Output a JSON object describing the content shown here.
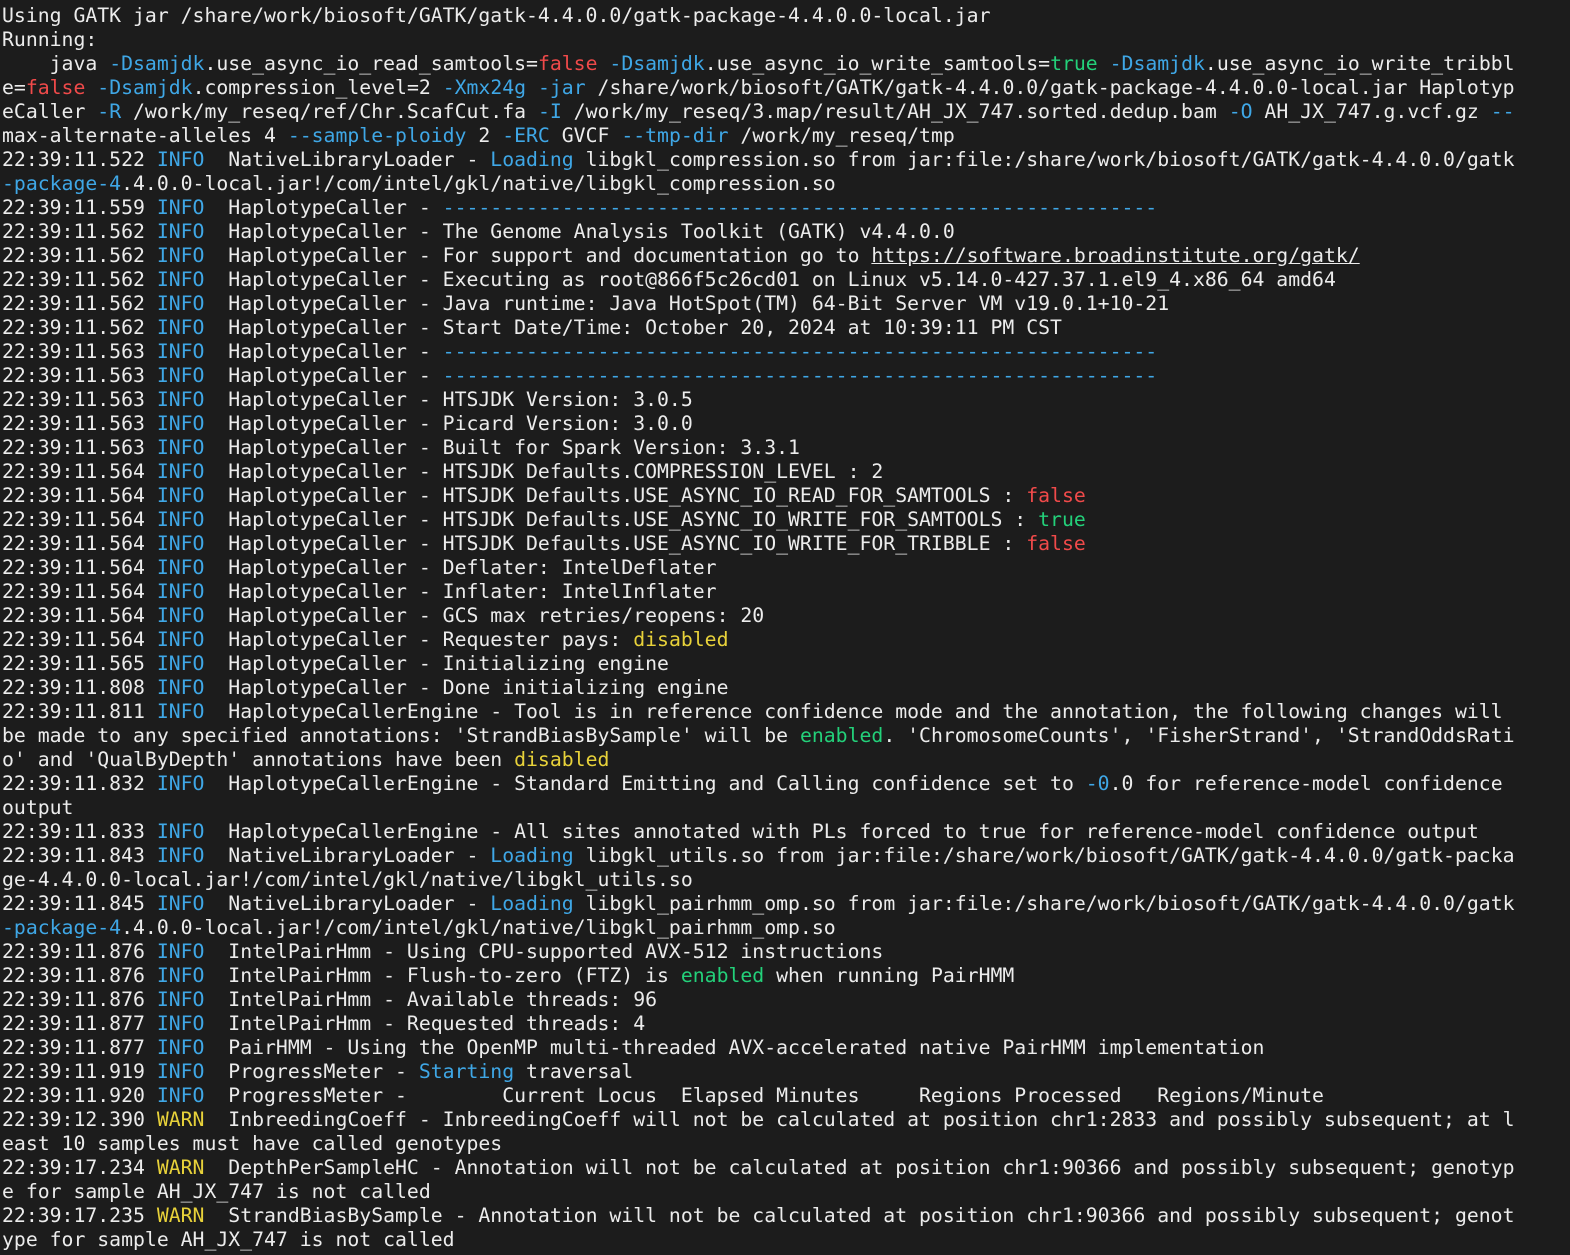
{
  "colors": {
    "background": "#1c1c1c",
    "text": "#ececec",
    "info": "#3fa7e6",
    "false": "#f04a4a",
    "true": "#23d17a",
    "warn": "#e8d23a"
  },
  "lines": [
    [
      {
        "t": "Using GATK jar /share/work/biosoft/GATK/gatk-4.4.0.0/gatk-package-4.4.0.0-local.jar"
      }
    ],
    [
      {
        "t": "Running:"
      }
    ],
    [
      {
        "t": "    java "
      },
      {
        "t": "-Dsamjdk",
        "c": "blue"
      },
      {
        "t": ".use_async_io_read_samtools="
      },
      {
        "t": "false",
        "c": "red"
      },
      {
        "t": " "
      },
      {
        "t": "-Dsamjdk",
        "c": "blue"
      },
      {
        "t": ".use_async_io_write_samtools="
      },
      {
        "t": "true",
        "c": "green"
      },
      {
        "t": " "
      },
      {
        "t": "-Dsamjdk",
        "c": "blue"
      },
      {
        "t": ".use_async_io_write_tribbl"
      }
    ],
    [
      {
        "t": "e="
      },
      {
        "t": "false",
        "c": "red"
      },
      {
        "t": " "
      },
      {
        "t": "-Dsamjdk",
        "c": "blue"
      },
      {
        "t": ".compression_level=2 "
      },
      {
        "t": "-Xmx24g",
        "c": "blue"
      },
      {
        "t": " "
      },
      {
        "t": "-jar",
        "c": "blue"
      },
      {
        "t": " /share/work/biosoft/GATK/gatk-4.4.0.0/gatk-package-4.4.0.0-local.jar Haplotyp"
      }
    ],
    [
      {
        "t": "eCaller "
      },
      {
        "t": "-R",
        "c": "blue"
      },
      {
        "t": " /work/my_reseq/ref/Chr.ScafCut.fa "
      },
      {
        "t": "-I",
        "c": "blue"
      },
      {
        "t": " /work/my_reseq/3.map/result/AH_JX_747.sorted.dedup.bam "
      },
      {
        "t": "-O",
        "c": "blue"
      },
      {
        "t": " AH_JX_747.g.vcf.gz "
      },
      {
        "t": "--",
        "c": "blue"
      }
    ],
    [
      {
        "t": "max-alternate-alleles 4 "
      },
      {
        "t": "--sample-ploidy",
        "c": "blue"
      },
      {
        "t": " 2 "
      },
      {
        "t": "-ERC",
        "c": "blue"
      },
      {
        "t": " GVCF "
      },
      {
        "t": "--tmp-dir",
        "c": "blue"
      },
      {
        "t": " /work/my_reseq/tmp"
      }
    ],
    [
      {
        "t": "22:39:11.522 "
      },
      {
        "t": "INFO",
        "c": "blue"
      },
      {
        "t": "  NativeLibraryLoader - "
      },
      {
        "t": "Loading",
        "c": "blue"
      },
      {
        "t": " libgkl_compression.so from jar:file:/share/work/biosoft/GATK/gatk-4.4.0.0/gatk"
      }
    ],
    [
      {
        "t": "-package-4",
        "c": "blue"
      },
      {
        "t": ".4.0.0-local.jar!/com/intel/gkl/native/libgkl_compression.so"
      }
    ],
    [
      {
        "t": "22:39:11.559 "
      },
      {
        "t": "INFO",
        "c": "blue"
      },
      {
        "t": "  HaplotypeCaller - "
      },
      {
        "t": "------------------------------------------------------------",
        "c": "blue"
      }
    ],
    [
      {
        "t": "22:39:11.562 "
      },
      {
        "t": "INFO",
        "c": "blue"
      },
      {
        "t": "  HaplotypeCaller - The Genome Analysis Toolkit (GATK) v4.4.0.0"
      }
    ],
    [
      {
        "t": "22:39:11.562 "
      },
      {
        "t": "INFO",
        "c": "blue"
      },
      {
        "t": "  HaplotypeCaller - For support and documentation go to "
      },
      {
        "t": "https://software.broadinstitute.org/gatk/",
        "c": "link"
      }
    ],
    [
      {
        "t": "22:39:11.562 "
      },
      {
        "t": "INFO",
        "c": "blue"
      },
      {
        "t": "  HaplotypeCaller - Executing as root@866f5c26cd01 on Linux v5.14.0-427.37.1.el9_4.x86_64 amd64"
      }
    ],
    [
      {
        "t": "22:39:11.562 "
      },
      {
        "t": "INFO",
        "c": "blue"
      },
      {
        "t": "  HaplotypeCaller - Java runtime: Java HotSpot(TM) 64-Bit Server VM v19.0.1+10-21"
      }
    ],
    [
      {
        "t": "22:39:11.562 "
      },
      {
        "t": "INFO",
        "c": "blue"
      },
      {
        "t": "  HaplotypeCaller - Start Date/Time: October 20, 2024 at 10:39:11 PM CST"
      }
    ],
    [
      {
        "t": "22:39:11.563 "
      },
      {
        "t": "INFO",
        "c": "blue"
      },
      {
        "t": "  HaplotypeCaller - "
      },
      {
        "t": "------------------------------------------------------------",
        "c": "blue"
      }
    ],
    [
      {
        "t": "22:39:11.563 "
      },
      {
        "t": "INFO",
        "c": "blue"
      },
      {
        "t": "  HaplotypeCaller - "
      },
      {
        "t": "------------------------------------------------------------",
        "c": "blue"
      }
    ],
    [
      {
        "t": "22:39:11.563 "
      },
      {
        "t": "INFO",
        "c": "blue"
      },
      {
        "t": "  HaplotypeCaller - HTSJDK Version: 3.0.5"
      }
    ],
    [
      {
        "t": "22:39:11.563 "
      },
      {
        "t": "INFO",
        "c": "blue"
      },
      {
        "t": "  HaplotypeCaller - Picard Version: 3.0.0"
      }
    ],
    [
      {
        "t": "22:39:11.563 "
      },
      {
        "t": "INFO",
        "c": "blue"
      },
      {
        "t": "  HaplotypeCaller - Built for Spark Version: 3.3.1"
      }
    ],
    [
      {
        "t": "22:39:11.564 "
      },
      {
        "t": "INFO",
        "c": "blue"
      },
      {
        "t": "  HaplotypeCaller - HTSJDK Defaults.COMPRESSION_LEVEL : 2"
      }
    ],
    [
      {
        "t": "22:39:11.564 "
      },
      {
        "t": "INFO",
        "c": "blue"
      },
      {
        "t": "  HaplotypeCaller - HTSJDK Defaults.USE_ASYNC_IO_READ_FOR_SAMTOOLS : "
      },
      {
        "t": "false",
        "c": "red"
      }
    ],
    [
      {
        "t": "22:39:11.564 "
      },
      {
        "t": "INFO",
        "c": "blue"
      },
      {
        "t": "  HaplotypeCaller - HTSJDK Defaults.USE_ASYNC_IO_WRITE_FOR_SAMTOOLS : "
      },
      {
        "t": "true",
        "c": "green"
      }
    ],
    [
      {
        "t": "22:39:11.564 "
      },
      {
        "t": "INFO",
        "c": "blue"
      },
      {
        "t": "  HaplotypeCaller - HTSJDK Defaults.USE_ASYNC_IO_WRITE_FOR_TRIBBLE : "
      },
      {
        "t": "false",
        "c": "red"
      }
    ],
    [
      {
        "t": "22:39:11.564 "
      },
      {
        "t": "INFO",
        "c": "blue"
      },
      {
        "t": "  HaplotypeCaller - Deflater: IntelDeflater"
      }
    ],
    [
      {
        "t": "22:39:11.564 "
      },
      {
        "t": "INFO",
        "c": "blue"
      },
      {
        "t": "  HaplotypeCaller - Inflater: IntelInflater"
      }
    ],
    [
      {
        "t": "22:39:11.564 "
      },
      {
        "t": "INFO",
        "c": "blue"
      },
      {
        "t": "  HaplotypeCaller - GCS max retries/reopens: 20"
      }
    ],
    [
      {
        "t": "22:39:11.564 "
      },
      {
        "t": "INFO",
        "c": "blue"
      },
      {
        "t": "  HaplotypeCaller - Requester pays: "
      },
      {
        "t": "disabled",
        "c": "yellow"
      }
    ],
    [
      {
        "t": "22:39:11.565 "
      },
      {
        "t": "INFO",
        "c": "blue"
      },
      {
        "t": "  HaplotypeCaller - Initializing engine"
      }
    ],
    [
      {
        "t": "22:39:11.808 "
      },
      {
        "t": "INFO",
        "c": "blue"
      },
      {
        "t": "  HaplotypeCaller - Done initializing engine"
      }
    ],
    [
      {
        "t": "22:39:11.811 "
      },
      {
        "t": "INFO",
        "c": "blue"
      },
      {
        "t": "  HaplotypeCallerEngine - Tool is in reference confidence mode and the annotation, the following changes will"
      }
    ],
    [
      {
        "t": "be made to any specified annotations: 'StrandBiasBySample' will be "
      },
      {
        "t": "enabled",
        "c": "green"
      },
      {
        "t": ". 'ChromosomeCounts', 'FisherStrand', 'StrandOddsRati"
      }
    ],
    [
      {
        "t": "o' and 'QualByDepth' annotations have been "
      },
      {
        "t": "disabled",
        "c": "yellow"
      }
    ],
    [
      {
        "t": "22:39:11.832 "
      },
      {
        "t": "INFO",
        "c": "blue"
      },
      {
        "t": "  HaplotypeCallerEngine - Standard Emitting and Calling confidence set to "
      },
      {
        "t": "-0",
        "c": "blue"
      },
      {
        "t": ".0 for reference-model confidence"
      }
    ],
    [
      {
        "t": "output"
      }
    ],
    [
      {
        "t": "22:39:11.833 "
      },
      {
        "t": "INFO",
        "c": "blue"
      },
      {
        "t": "  HaplotypeCallerEngine - All sites annotated with PLs forced to true for reference-model confidence output"
      }
    ],
    [
      {
        "t": "22:39:11.843 "
      },
      {
        "t": "INFO",
        "c": "blue"
      },
      {
        "t": "  NativeLibraryLoader - "
      },
      {
        "t": "Loading",
        "c": "blue"
      },
      {
        "t": " libgkl_utils.so from jar:file:/share/work/biosoft/GATK/gatk-4.4.0.0/gatk-packa"
      }
    ],
    [
      {
        "t": "ge-4.4.0.0-local.jar!/com/intel/gkl/native/libgkl_utils.so"
      }
    ],
    [
      {
        "t": "22:39:11.845 "
      },
      {
        "t": "INFO",
        "c": "blue"
      },
      {
        "t": "  NativeLibraryLoader - "
      },
      {
        "t": "Loading",
        "c": "blue"
      },
      {
        "t": " libgkl_pairhmm_omp.so from jar:file:/share/work/biosoft/GATK/gatk-4.4.0.0/gatk"
      }
    ],
    [
      {
        "t": "-package-4",
        "c": "blue"
      },
      {
        "t": ".4.0.0-local.jar!/com/intel/gkl/native/libgkl_pairhmm_omp.so"
      }
    ],
    [
      {
        "t": "22:39:11.876 "
      },
      {
        "t": "INFO",
        "c": "blue"
      },
      {
        "t": "  IntelPairHmm - Using CPU-supported AVX-512 instructions"
      }
    ],
    [
      {
        "t": "22:39:11.876 "
      },
      {
        "t": "INFO",
        "c": "blue"
      },
      {
        "t": "  IntelPairHmm - Flush-to-zero (FTZ) is "
      },
      {
        "t": "enabled",
        "c": "green"
      },
      {
        "t": " when running PairHMM"
      }
    ],
    [
      {
        "t": "22:39:11.876 "
      },
      {
        "t": "INFO",
        "c": "blue"
      },
      {
        "t": "  IntelPairHmm - Available threads: 96"
      }
    ],
    [
      {
        "t": "22:39:11.877 "
      },
      {
        "t": "INFO",
        "c": "blue"
      },
      {
        "t": "  IntelPairHmm - Requested threads: 4"
      }
    ],
    [
      {
        "t": "22:39:11.877 "
      },
      {
        "t": "INFO",
        "c": "blue"
      },
      {
        "t": "  PairHMM - Using the OpenMP multi-threaded AVX-accelerated native PairHMM implementation"
      }
    ],
    [
      {
        "t": "22:39:11.919 "
      },
      {
        "t": "INFO",
        "c": "blue"
      },
      {
        "t": "  ProgressMeter - "
      },
      {
        "t": "Starting",
        "c": "blue"
      },
      {
        "t": " traversal"
      }
    ],
    [
      {
        "t": "22:39:11.920 "
      },
      {
        "t": "INFO",
        "c": "blue"
      },
      {
        "t": "  ProgressMeter -        Current Locus  Elapsed Minutes     Regions Processed   Regions/Minute"
      }
    ],
    [
      {
        "t": "22:39:12.390 "
      },
      {
        "t": "WARN",
        "c": "yellow"
      },
      {
        "t": "  InbreedingCoeff - InbreedingCoeff will not be calculated at position chr1:2833 and possibly subsequent; at l"
      }
    ],
    [
      {
        "t": "east 10 samples must have called genotypes"
      }
    ],
    [
      {
        "t": "22:39:17.234 "
      },
      {
        "t": "WARN",
        "c": "yellow"
      },
      {
        "t": "  DepthPerSampleHC - Annotation will not be calculated at position chr1:90366 and possibly subsequent; genotyp"
      }
    ],
    [
      {
        "t": "e for sample AH_JX_747 is not called"
      }
    ],
    [
      {
        "t": "22:39:17.235 "
      },
      {
        "t": "WARN",
        "c": "yellow"
      },
      {
        "t": "  StrandBiasBySample - Annotation will not be calculated at position chr1:90366 and possibly subsequent; genot"
      }
    ],
    [
      {
        "t": "ype for sample AH_JX_747 is not called"
      }
    ]
  ]
}
